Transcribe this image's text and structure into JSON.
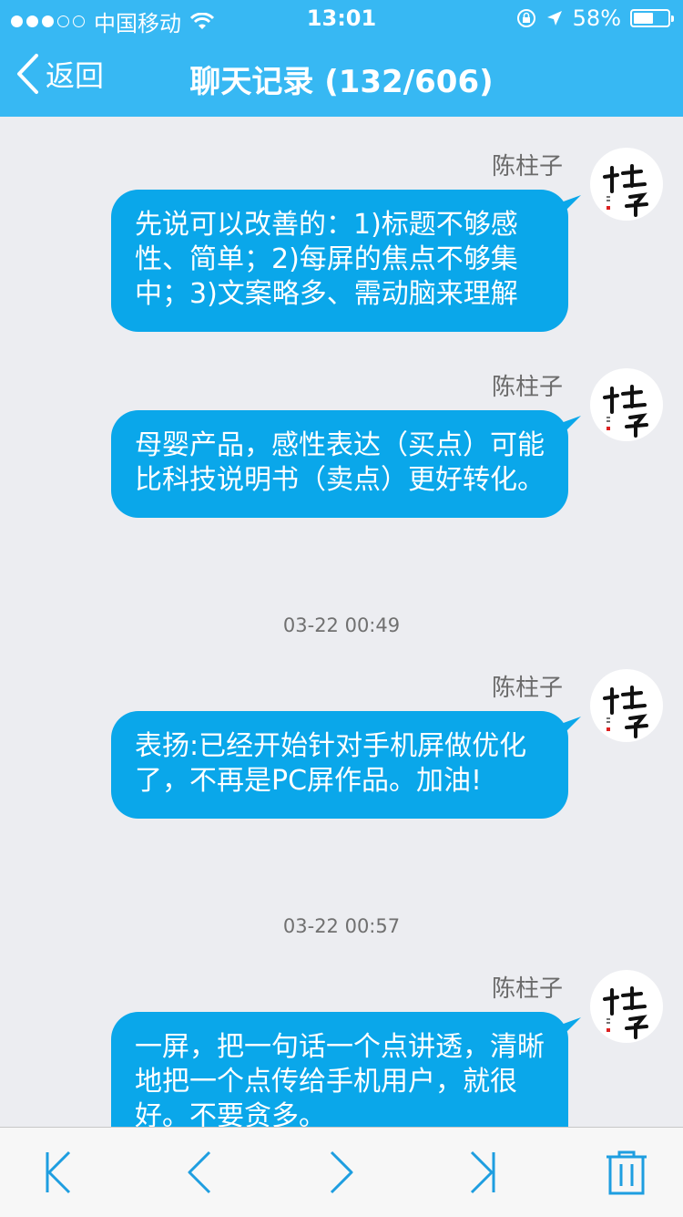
{
  "status_bar": {
    "carrier": "中国移动",
    "time": "13:01",
    "battery": "58%",
    "battery_level": 0.58,
    "signal_bars": 3
  },
  "nav": {
    "back_label": "返回",
    "title": "聊天记录 (132/606)"
  },
  "messages": [
    {
      "sender": "陈柱子",
      "text": "先说可以改善的：1)标题不够感性、简单；2)每屏的焦点不够集中；3)文案略多、需动脑来理解"
    },
    {
      "sender": "陈柱子",
      "text": "母婴产品，感性表达（买点）可能比科技说明书（卖点）更好转化。"
    },
    {
      "sender": "陈柱子",
      "text": "表扬:已经开始针对手机屏做优化了，不再是PC屏作品。加油!"
    },
    {
      "sender": "陈柱子",
      "text": "一屏，把一句话一个点讲透，清晰地把一个点传给手机用户，就很好。不要贪多。"
    }
  ],
  "timestamps": [
    "03-22 00:49",
    "03-22 00:57"
  ],
  "toolbar": {
    "icons": [
      "first-page-icon",
      "previous-page-icon",
      "next-page-icon",
      "last-page-icon",
      "trash-icon"
    ]
  },
  "colors": {
    "header": "#37b8f3",
    "bubble": "#0aa7ea",
    "background": "#ecedf1",
    "toolbar_icon": "#1e9ee0"
  }
}
